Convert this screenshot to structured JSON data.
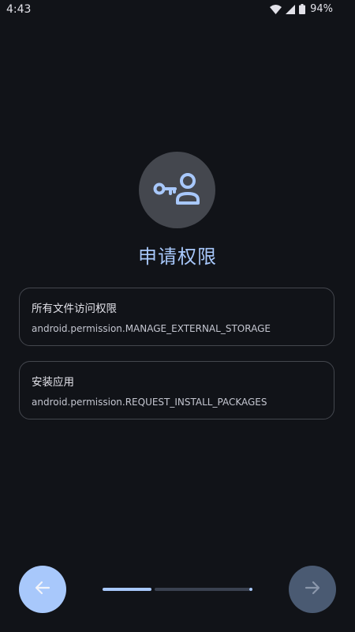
{
  "status_bar": {
    "time": "4:43",
    "battery": "94%",
    "icons": [
      "wifi-icon",
      "signal-icon",
      "battery-icon"
    ]
  },
  "hero": {
    "icon": "key-person-icon",
    "title": "申请权限"
  },
  "permissions": [
    {
      "name": "所有文件访问权限",
      "id": "android.permission.MANAGE_EXTERNAL_STORAGE"
    },
    {
      "name": "安装应用",
      "id": "android.permission.REQUEST_INSTALL_PACKAGES"
    }
  ],
  "navigation": {
    "back_icon": "arrow-left-icon",
    "next_icon": "arrow-right-icon",
    "progress_steps": 3,
    "current_step": 1
  },
  "colors": {
    "background": "#111318",
    "accent": "#a8c8fb",
    "card_border": "#44474e",
    "next_disabled": "#4a5a72"
  }
}
